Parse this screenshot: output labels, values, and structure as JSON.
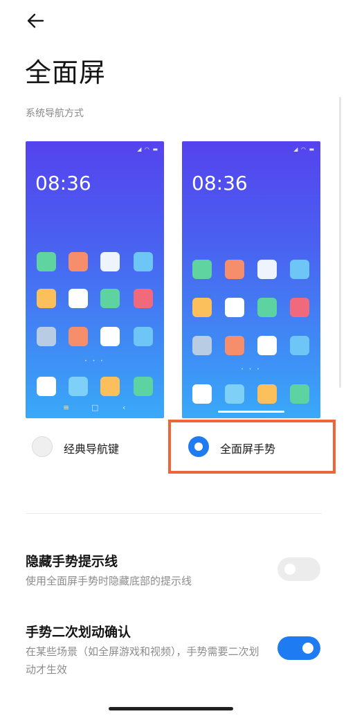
{
  "header": {
    "back_icon": "arrow-left-icon",
    "title": "全面屏"
  },
  "section": {
    "label": "系统导航方式"
  },
  "previews": [
    {
      "clock": "08:36",
      "status_icons": "◢ ◠ ▬",
      "dots": "• • •",
      "nav_keys": [
        "≡",
        "□",
        "‹"
      ]
    },
    {
      "clock": "08:36",
      "status_icons": "◢ ◠ ▬",
      "dots": "• • •"
    }
  ],
  "icon_rows": {
    "row1": [
      "#5fd3a0",
      "#f78e6b",
      "#eef4fb",
      "#6ec6f6"
    ],
    "row2": [
      "#fbbf5c",
      "#ffffff",
      "#5cd3a0",
      "#f1697d"
    ],
    "row3": [
      "#b8cde4",
      "#f78e6b",
      "#ffffff",
      "#6ec6f6"
    ],
    "dock": [
      "#ffffff",
      "#7fd0f7",
      "#fbbf5c",
      "#5cd3a0"
    ]
  },
  "options": [
    {
      "label": "经典导航键",
      "selected": false
    },
    {
      "label": "全面屏手势",
      "selected": true
    }
  ],
  "settings": [
    {
      "title": "隐藏手势提示线",
      "description": "使用全面屏手势时隐藏底部的提示线",
      "enabled": false
    },
    {
      "title": "手势二次划动确认",
      "description": "在某些场景（如全屏游戏和视频），手势需要二次划动才生效",
      "enabled": true
    }
  ],
  "colors": {
    "accent": "#1f7bf2",
    "highlight": "#f0643a",
    "preview_top": "#5543ee",
    "preview_bottom": "#39a9f8"
  }
}
